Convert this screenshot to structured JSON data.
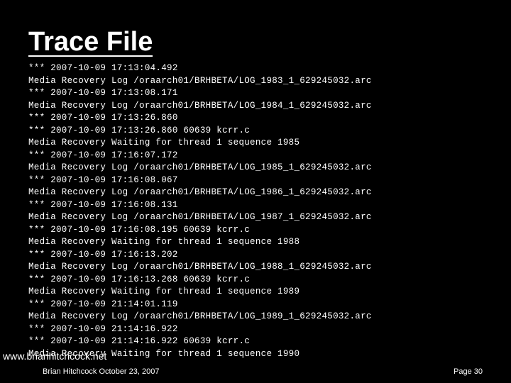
{
  "title": "Trace File",
  "trace_lines": [
    "*** 2007-10-09 17:13:04.492",
    "Media Recovery Log /oraarch01/BRHBETA/LOG_1983_1_629245032.arc",
    "*** 2007-10-09 17:13:08.171",
    "Media Recovery Log /oraarch01/BRHBETA/LOG_1984_1_629245032.arc",
    "*** 2007-10-09 17:13:26.860",
    "*** 2007-10-09 17:13:26.860 60639 kcrr.c",
    "Media Recovery Waiting for thread 1 sequence 1985",
    "*** 2007-10-09 17:16:07.172",
    "Media Recovery Log /oraarch01/BRHBETA/LOG_1985_1_629245032.arc",
    "*** 2007-10-09 17:16:08.067",
    "Media Recovery Log /oraarch01/BRHBETA/LOG_1986_1_629245032.arc",
    "*** 2007-10-09 17:16:08.131",
    "Media Recovery Log /oraarch01/BRHBETA/LOG_1987_1_629245032.arc",
    "*** 2007-10-09 17:16:08.195 60639 kcrr.c",
    "Media Recovery Waiting for thread 1 sequence 1988",
    "*** 2007-10-09 17:16:13.202",
    "Media Recovery Log /oraarch01/BRHBETA/LOG_1988_1_629245032.arc",
    "*** 2007-10-09 17:16:13.268 60639 kcrr.c",
    "Media Recovery Waiting for thread 1 sequence 1989",
    "*** 2007-10-09 21:14:01.119",
    "Media Recovery Log /oraarch01/BRHBETA/LOG_1989_1_629245032.arc",
    "*** 2007-10-09 21:14:16.922",
    "*** 2007-10-09 21:14:16.922 60639 kcrr.c",
    "Media Recovery Waiting for thread 1 sequence 1990"
  ],
  "footer": {
    "url": "www.brianhitchcock.net",
    "left": "Brian Hitchcock  October 23, 2007",
    "right": "Page 30"
  }
}
